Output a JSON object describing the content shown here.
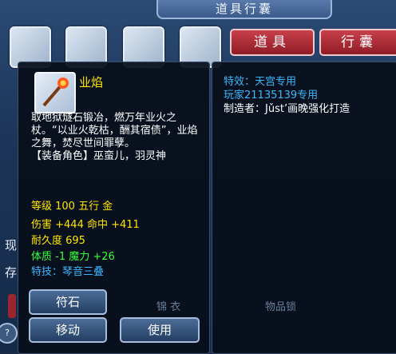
{
  "window": {
    "title": "道具行囊"
  },
  "tabs": {
    "items": "道具",
    "bag": "行囊"
  },
  "item": {
    "icon": "flame-staff-icon",
    "name": "业焰",
    "description": "取地狱燧石锻冶，燃万年业火之杖。“以业火乾枯，酬其宿债”，业焰之舞，焚尽世间罪孽。",
    "role": "【装备角色】巫蛮儿，羽灵神",
    "level_line": "等级 100  五行 金",
    "damage_line": "伤害 +444 命中 +411",
    "durability_line": "耐久度 695",
    "attr_line": "体质 -1 魔力 +26",
    "skill_line": "特技：琴音三叠"
  },
  "details": {
    "effect": "特效：天宫专用",
    "player": "玩家21135139专用",
    "maker": "制造者：Jǔst’画晚强化打造"
  },
  "buttons": {
    "rune": "符石",
    "move": "移动",
    "use": "使用"
  },
  "edge_chars": {
    "left1": "现",
    "left2": "存"
  },
  "background_labels": {
    "l1": "锦 衣",
    "l2": "物品锁"
  },
  "colors": {
    "name": "#ffe400",
    "stat": "#ffe400",
    "bonus": "#39ff39",
    "special": "#3ab8ff"
  }
}
